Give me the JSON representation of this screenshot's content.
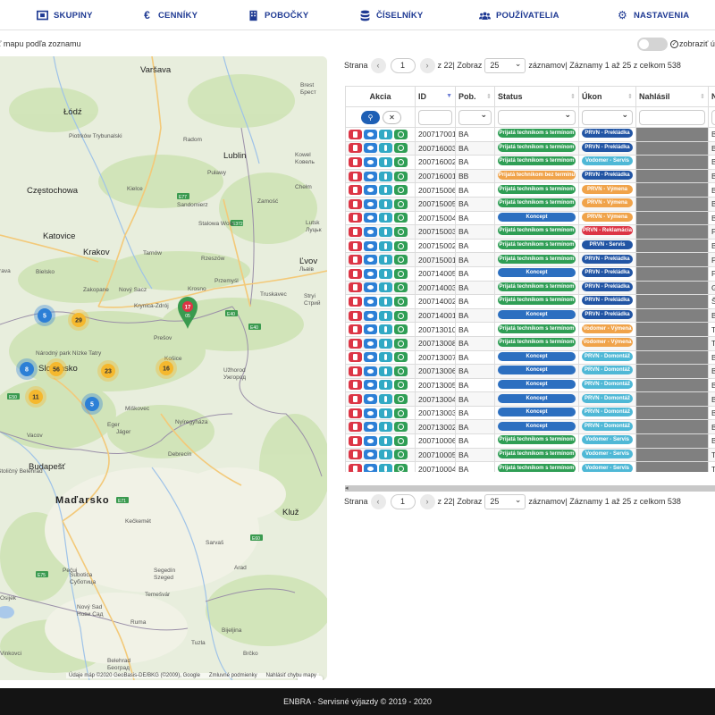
{
  "nav": {
    "items": [
      {
        "label": "SKUPINY",
        "icon": "sitemap-icon"
      },
      {
        "label": "CENNÍKY",
        "icon": "euro-icon"
      },
      {
        "label": "POBOČKY",
        "icon": "building-icon"
      },
      {
        "label": "ČÍSELNÍKY",
        "icon": "database-icon"
      },
      {
        "label": "POUŽÍVATELIA",
        "icon": "users-icon"
      },
      {
        "label": "NASTAVENIA",
        "icon": "gear-icon"
      }
    ]
  },
  "filter": {
    "map_label": "ť mapu podľa zoznamu",
    "show_label": "zobraziť úko"
  },
  "map": {
    "cities": [
      {
        "name": "Varšava",
        "size": "big"
      },
      {
        "name": "Brest",
        "size": "small"
      },
      {
        "name": "Бpecт",
        "size": "small"
      },
      {
        "name": "Łódź",
        "size": "big"
      },
      {
        "name": "Piotrków Trybunalski",
        "size": "small"
      },
      {
        "name": "Lublin",
        "size": "big"
      },
      {
        "name": "Kowel",
        "size": "small"
      },
      {
        "name": "Kовель",
        "size": "small"
      },
      {
        "name": "Radom",
        "size": "small"
      },
      {
        "name": "Puławy",
        "size": "small"
      },
      {
        "name": "Chełm",
        "size": "small"
      },
      {
        "name": "Częstochowa",
        "size": "big"
      },
      {
        "name": "Kielce",
        "size": "small"
      },
      {
        "name": "Zamość",
        "size": "small"
      },
      {
        "name": "Lutsk",
        "size": "small"
      },
      {
        "name": "Луцьк",
        "size": "small"
      },
      {
        "name": "Katovice",
        "size": "big"
      },
      {
        "name": "Sandomierz",
        "size": "small"
      },
      {
        "name": "Stalowa Wola",
        "size": "small"
      },
      {
        "name": "Krakov",
        "size": "big"
      },
      {
        "name": "Tarnów",
        "size": "small"
      },
      {
        "name": "Rzeszów",
        "size": "small"
      },
      {
        "name": "Ľvov",
        "size": "big"
      },
      {
        "name": "Львів",
        "size": "small"
      },
      {
        "name": "Bielsko",
        "size": "small"
      },
      {
        "name": "strava",
        "size": "small"
      },
      {
        "name": "Nový Sacz",
        "size": "small"
      },
      {
        "name": "Krosno",
        "size": "small"
      },
      {
        "name": "Przemyśl",
        "size": "small"
      },
      {
        "name": "Zakopane",
        "size": "small"
      },
      {
        "name": "Krynica-Zdrój",
        "size": "small"
      },
      {
        "name": "Truskavec",
        "size": "small"
      },
      {
        "name": "Stryi",
        "size": "small"
      },
      {
        "name": "Стрий",
        "size": "small"
      },
      {
        "name": "Prešov",
        "size": "small"
      },
      {
        "name": "Národný park Nízke Tatry",
        "size": "small"
      },
      {
        "name": "Slovensko",
        "size": "big"
      },
      {
        "name": "Košice",
        "size": "small"
      },
      {
        "name": "Užhorod",
        "size": "small"
      },
      {
        "name": "Ужгород",
        "size": "small"
      },
      {
        "name": "Miškovec",
        "size": "small"
      },
      {
        "name": "Nyíregyháza",
        "size": "small"
      },
      {
        "name": "Vacov",
        "size": "small"
      },
      {
        "name": "Eger",
        "size": "small"
      },
      {
        "name": "Jáger",
        "size": "small"
      },
      {
        "name": "Debrecín",
        "size": "small"
      },
      {
        "name": "Budapešť",
        "size": "big"
      },
      {
        "name": "Stoličný Belehrad",
        "size": "small"
      },
      {
        "name": "Maďarsko",
        "size": "country"
      },
      {
        "name": "Kečkemét",
        "size": "small"
      },
      {
        "name": "Sarvaš",
        "size": "small"
      },
      {
        "name": "Kluž",
        "size": "big"
      },
      {
        "name": "Segedín",
        "size": "small"
      },
      {
        "name": "Szeged",
        "size": "small"
      },
      {
        "name": "Arad",
        "size": "small"
      },
      {
        "name": "Pečuj",
        "size": "small"
      },
      {
        "name": "Subotica",
        "size": "small"
      },
      {
        "name": "Суботица",
        "size": "small"
      },
      {
        "name": "Temešvár",
        "size": "small"
      },
      {
        "name": "Osijek",
        "size": "small"
      },
      {
        "name": "Nový Sad",
        "size": "small"
      },
      {
        "name": "Нови Сад",
        "size": "small"
      },
      {
        "name": "Belehrad",
        "size": "small"
      },
      {
        "name": "Београд",
        "size": "small"
      },
      {
        "name": "Ruma",
        "size": "small"
      },
      {
        "name": "Bijeljina",
        "size": "small"
      },
      {
        "name": "Tuzla",
        "size": "small"
      },
      {
        "name": "Brčko",
        "size": "small"
      },
      {
        "name": "Vinkovci",
        "size": "small"
      }
    ],
    "clusters": [
      {
        "count": "29",
        "color": "#f5b82e"
      },
      {
        "count": "5",
        "color": "#2c7fd6"
      },
      {
        "count": "8",
        "color": "#2c7fd6"
      },
      {
        "count": "56",
        "color": "#f5b82e"
      },
      {
        "count": "23",
        "color": "#f5b82e"
      },
      {
        "count": "16",
        "color": "#f5b82e"
      },
      {
        "count": "11",
        "color": "#f5b82e"
      },
      {
        "count": "5",
        "color": "#2c7fd6"
      }
    ],
    "pins": [
      {
        "count": "17",
        "sub": "05",
        "color": "#dc3545"
      }
    ],
    "attribution": [
      "Údaje máp ©2020 GeoBasis-DE/BKG (©2009), Google",
      "Zmluvné podmienky",
      "Nahlásiť chybu mapy"
    ],
    "zoom_in": "+",
    "zoom_out": "−"
  },
  "pager": {
    "strana": "Strana",
    "prev": "‹",
    "next": "›",
    "page": "1",
    "of": "z 22",
    "zobraz": "| Zobraz",
    "per_page": "25",
    "zaznamov": "záznamov",
    "summary": "| Záznamy 1 až 25 z celkom 538"
  },
  "table": {
    "headers": [
      "Akcia",
      "ID",
      "Pob.",
      "Status",
      "Úkon",
      "Nahlásil",
      "N"
    ],
    "search_icon": "search-icon",
    "clear_label": "✕",
    "rows": [
      {
        "id": "200717001",
        "pob": "BA",
        "status": "Prijatá technikom s termínom",
        "status_color": "#2f9e55",
        "ukon": "PRVN - Prekládka",
        "ukon_color": "#2255a4",
        "n": "Br"
      },
      {
        "id": "200716003",
        "pob": "BA",
        "status": "Prijatá technikom s termínom",
        "status_color": "#2f9e55",
        "ukon": "PRVN - Prekládka",
        "ukon_color": "#2255a4",
        "n": "Br"
      },
      {
        "id": "200716002",
        "pob": "BA",
        "status": "Prijatá technikom s termínom",
        "status_color": "#2f9e55",
        "ukon": "Vodomer - Servis",
        "ukon_color": "#4fb8d6",
        "n": "Br"
      },
      {
        "id": "200716001",
        "pob": "BB",
        "status": "Prijatá technikom bez termínu",
        "status_color": "#f0a34a",
        "ukon": "PRVN - Prekládka",
        "ukon_color": "#2255a4",
        "n": "Ba"
      },
      {
        "id": "200715006",
        "pob": "BA",
        "status": "Prijatá technikom s termínom",
        "status_color": "#2f9e55",
        "ukon": "PRVN - Výmena",
        "ukon_color": "#f0a34a",
        "n": "Br"
      },
      {
        "id": "200715005",
        "pob": "BA",
        "status": "Prijatá technikom s termínom",
        "status_color": "#2f9e55",
        "ukon": "PRVN - Výmena",
        "ukon_color": "#f0a34a",
        "n": "Br"
      },
      {
        "id": "200715004",
        "pob": "BA",
        "status": "Koncept",
        "status_color": "#2c6fc0",
        "ukon": "PRVN - Výmena",
        "ukon_color": "#f0a34a",
        "n": "Br"
      },
      {
        "id": "200715003",
        "pob": "BA",
        "status": "Prijatá technikom s termínom",
        "status_color": "#2f9e55",
        "ukon": "PRVN - Reklamácia",
        "ukon_color": "#dc3545",
        "n": "Pe"
      },
      {
        "id": "200715002",
        "pob": "BA",
        "status": "Prijatá technikom s termínom",
        "status_color": "#2f9e55",
        "ukon": "PRVN - Servis",
        "ukon_color": "#2255a4",
        "n": "Br"
      },
      {
        "id": "200715001",
        "pob": "BA",
        "status": "Prijatá technikom s termínom",
        "status_color": "#2f9e55",
        "ukon": "PRVN - Prekládka",
        "ukon_color": "#2255a4",
        "n": "Pe"
      },
      {
        "id": "200714005",
        "pob": "BA",
        "status": "Koncept",
        "status_color": "#2c6fc0",
        "ukon": "PRVN - Prekládka",
        "ukon_color": "#2255a4",
        "n": "Pi"
      },
      {
        "id": "200714003",
        "pob": "BA",
        "status": "Prijatá technikom s termínom",
        "status_color": "#2f9e55",
        "ukon": "PRVN - Prekládka",
        "ukon_color": "#2255a4",
        "n": "Ga"
      },
      {
        "id": "200714002",
        "pob": "BA",
        "status": "Prijatá technikom s termínom",
        "status_color": "#2f9e55",
        "ukon": "PRVN - Prekládka",
        "ukon_color": "#2255a4",
        "n": "Ša"
      },
      {
        "id": "200714001",
        "pob": "BA",
        "status": "Koncept",
        "status_color": "#2c6fc0",
        "ukon": "PRVN - Prekládka",
        "ukon_color": "#2255a4",
        "n": "Br"
      },
      {
        "id": "200713010",
        "pob": "BA",
        "status": "Prijatá technikom s termínom",
        "status_color": "#2f9e55",
        "ukon": "Vodomer - Výmena",
        "ukon_color": "#f0a34a",
        "n": "Tr"
      },
      {
        "id": "200713008",
        "pob": "BA",
        "status": "Prijatá technikom s termínom",
        "status_color": "#2f9e55",
        "ukon": "Vodomer - Výmena",
        "ukon_color": "#f0a34a",
        "n": "Tr"
      },
      {
        "id": "200713007",
        "pob": "BA",
        "status": "Koncept",
        "status_color": "#2c6fc0",
        "ukon": "PRVN - Domontáž",
        "ukon_color": "#4fb8d6",
        "n": "Br"
      },
      {
        "id": "200713006",
        "pob": "BA",
        "status": "Koncept",
        "status_color": "#2c6fc0",
        "ukon": "PRVN - Domontáž",
        "ukon_color": "#4fb8d6",
        "n": "Br"
      },
      {
        "id": "200713005",
        "pob": "BA",
        "status": "Koncept",
        "status_color": "#2c6fc0",
        "ukon": "PRVN - Domontáž",
        "ukon_color": "#4fb8d6",
        "n": "Br"
      },
      {
        "id": "200713004",
        "pob": "BA",
        "status": "Koncept",
        "status_color": "#2c6fc0",
        "ukon": "PRVN - Domontáž",
        "ukon_color": "#4fb8d6",
        "n": "Br"
      },
      {
        "id": "200713003",
        "pob": "BA",
        "status": "Koncept",
        "status_color": "#2c6fc0",
        "ukon": "PRVN - Domontáž",
        "ukon_color": "#4fb8d6",
        "n": "Br"
      },
      {
        "id": "200713002",
        "pob": "BA",
        "status": "Koncept",
        "status_color": "#2c6fc0",
        "ukon": "PRVN - Domontáž",
        "ukon_color": "#4fb8d6",
        "n": "Br"
      },
      {
        "id": "200710006",
        "pob": "BA",
        "status": "Prijatá technikom s termínom",
        "status_color": "#2f9e55",
        "ukon": "Vodomer - Servis",
        "ukon_color": "#4fb8d6",
        "n": "Br"
      },
      {
        "id": "200710005",
        "pob": "BA",
        "status": "Prijatá technikom s termínom",
        "status_color": "#2f9e55",
        "ukon": "Vodomer - Servis",
        "ukon_color": "#4fb8d6",
        "n": "Tr"
      },
      {
        "id": "200710004",
        "pob": "BA",
        "status": "Prijatá technikom s termínom",
        "status_color": "#2f9e55",
        "ukon": "Vodomer - Servis",
        "ukon_color": "#4fb8d6",
        "n": "Tr"
      }
    ]
  },
  "footer": {
    "text": "ENBRA - Servisné výjazdy  © 2019 - 2020"
  }
}
